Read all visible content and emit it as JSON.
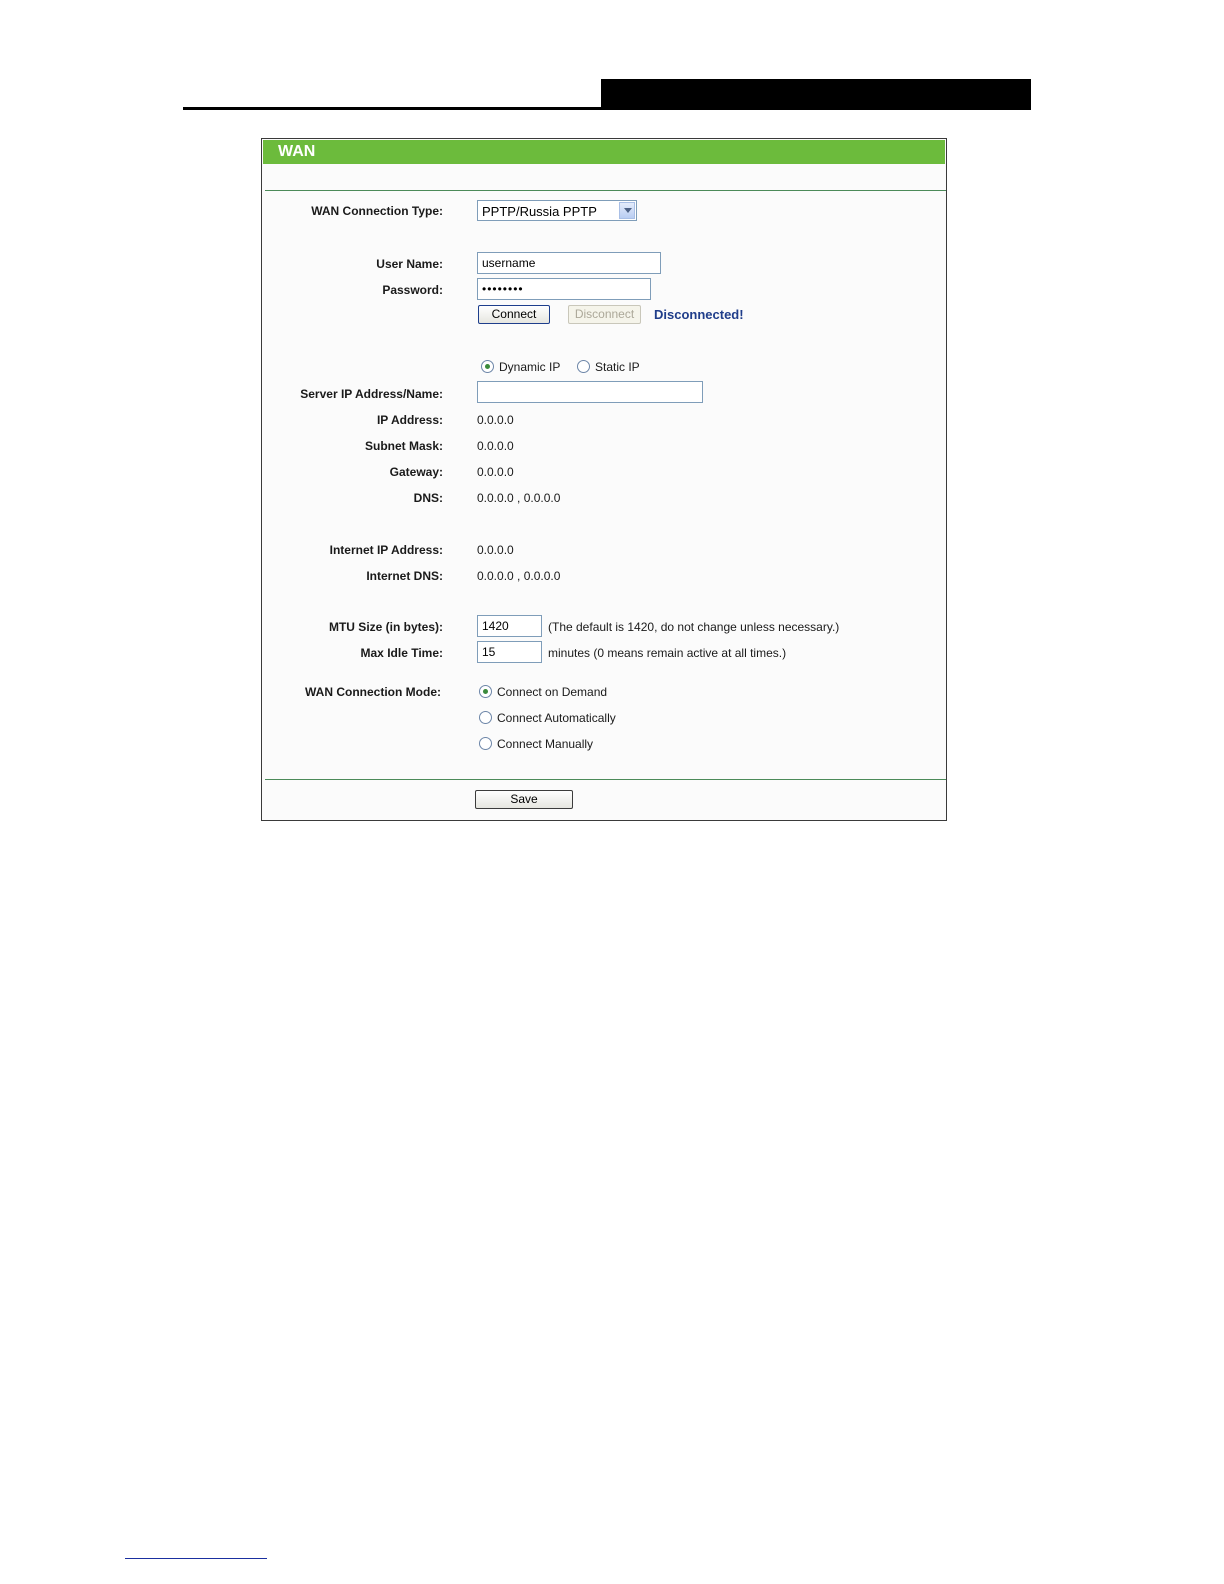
{
  "panel": {
    "title": "WAN"
  },
  "wan_type": {
    "label": "WAN Connection Type:",
    "selected": "PPTP/Russia PPTP"
  },
  "username": {
    "label": "User Name:",
    "value": "username"
  },
  "password": {
    "label": "Password:",
    "value": "••••••••"
  },
  "buttons": {
    "connect": "Connect",
    "disconnect": "Disconnect",
    "save": "Save"
  },
  "status": "Disconnected!",
  "ip_mode": {
    "options": [
      "Dynamic IP",
      "Static IP"
    ],
    "selected": "Dynamic IP"
  },
  "server_ip": {
    "label": "Server IP Address/Name:",
    "value": ""
  },
  "ip_address": {
    "label": "IP Address:",
    "value": "0.0.0.0"
  },
  "subnet_mask": {
    "label": "Subnet Mask:",
    "value": "0.0.0.0"
  },
  "gateway": {
    "label": "Gateway:",
    "value": "0.0.0.0"
  },
  "dns": {
    "label": "DNS:",
    "value": "0.0.0.0 , 0.0.0.0"
  },
  "internet_ip": {
    "label": "Internet IP Address:",
    "value": "0.0.0.0"
  },
  "internet_dns": {
    "label": "Internet DNS:",
    "value": "0.0.0.0 , 0.0.0.0"
  },
  "mtu": {
    "label": "MTU Size (in bytes):",
    "value": "1420",
    "hint": "(The default is 1420, do not change unless necessary.)"
  },
  "idle": {
    "label": "Max Idle Time:",
    "value": "15",
    "hint": "minutes (0 means remain active at all times.)"
  },
  "conn_mode": {
    "label": "WAN Connection Mode:",
    "options": [
      "Connect on Demand",
      "Connect Automatically",
      "Connect Manually"
    ],
    "selected": "Connect on Demand"
  },
  "colors": {
    "title_bar": "#6cbb3c",
    "status": "#1f3d8a",
    "rule": "#4b8a59"
  }
}
